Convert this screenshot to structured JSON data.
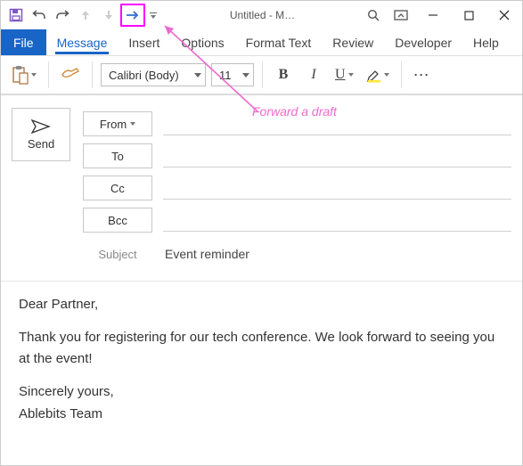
{
  "window": {
    "title": "Untitled  -  M…"
  },
  "tabs": {
    "file": "File",
    "items": [
      "Message",
      "Insert",
      "Options",
      "Format Text",
      "Review",
      "Developer",
      "Help"
    ],
    "active_index": 0
  },
  "ribbon": {
    "font_name": "Calibri (Body)",
    "font_size": "11",
    "bold": "B",
    "italic": "I",
    "underline": "U",
    "more": "⋯"
  },
  "compose": {
    "send": "Send",
    "from": "From",
    "to": "To",
    "cc": "Cc",
    "bcc": "Bcc",
    "subject_label": "Subject",
    "subject_value": "Event reminder"
  },
  "body": {
    "p1": "Dear Partner,",
    "p2": "Thank you for registering for our tech conference. We look forward to seeing you at the event!",
    "p3": "Sincerely yours,",
    "p4": "Ablebits Team"
  },
  "annotation": {
    "text": "Forward a draft"
  }
}
